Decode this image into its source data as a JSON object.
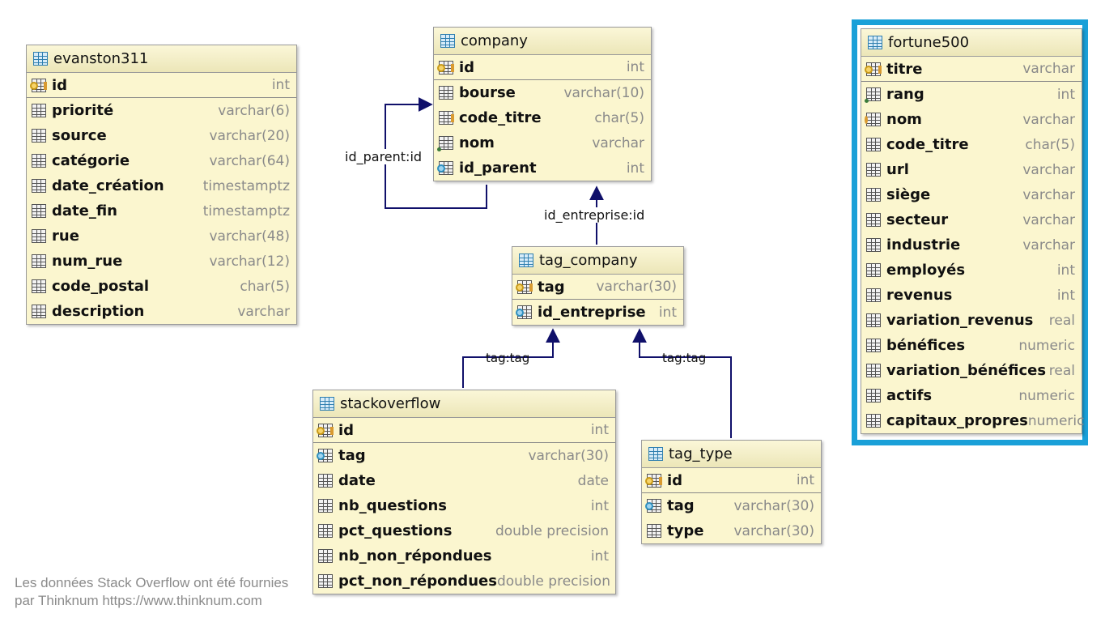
{
  "tables": {
    "evanston311": {
      "name": "evanston311",
      "fields": [
        {
          "name": "id",
          "type": "int"
        },
        {
          "name": "priorité",
          "type": "varchar(6)"
        },
        {
          "name": "source",
          "type": "varchar(20)"
        },
        {
          "name": "catégorie",
          "type": "varchar(64)"
        },
        {
          "name": "date_création",
          "type": "timestamptz"
        },
        {
          "name": "date_fin",
          "type": "timestamptz"
        },
        {
          "name": "rue",
          "type": "varchar(48)"
        },
        {
          "name": "num_rue",
          "type": "varchar(12)"
        },
        {
          "name": "code_postal",
          "type": "char(5)"
        },
        {
          "name": "description",
          "type": "varchar"
        }
      ]
    },
    "company": {
      "name": "company",
      "fields": [
        {
          "name": "id",
          "type": "int"
        },
        {
          "name": "bourse",
          "type": "varchar(10)"
        },
        {
          "name": "code_titre",
          "type": "char(5)"
        },
        {
          "name": "nom",
          "type": "varchar"
        },
        {
          "name": "id_parent",
          "type": "int"
        }
      ]
    },
    "tag_company": {
      "name": "tag_company",
      "fields": [
        {
          "name": "tag",
          "type": "varchar(30)"
        },
        {
          "name": "id_entreprise",
          "type": "int"
        }
      ]
    },
    "stackoverflow": {
      "name": "stackoverflow",
      "fields": [
        {
          "name": "id",
          "type": "int"
        },
        {
          "name": "tag",
          "type": "varchar(30)"
        },
        {
          "name": "date",
          "type": "date"
        },
        {
          "name": "nb_questions",
          "type": "int"
        },
        {
          "name": "pct_questions",
          "type": "double precision"
        },
        {
          "name": "nb_non_répondues",
          "type": "int"
        },
        {
          "name": "pct_non_répondues",
          "type": "double precision"
        }
      ]
    },
    "tag_type": {
      "name": "tag_type",
      "fields": [
        {
          "name": "id",
          "type": "int"
        },
        {
          "name": "tag",
          "type": "varchar(30)"
        },
        {
          "name": "type",
          "type": "varchar(30)"
        }
      ]
    },
    "fortune500": {
      "name": "fortune500",
      "fields": [
        {
          "name": "titre",
          "type": "varchar"
        },
        {
          "name": "rang",
          "type": "int"
        },
        {
          "name": "nom",
          "type": "varchar"
        },
        {
          "name": "code_titre",
          "type": "char(5)"
        },
        {
          "name": "url",
          "type": "varchar"
        },
        {
          "name": "siège",
          "type": "varchar"
        },
        {
          "name": "secteur",
          "type": "varchar"
        },
        {
          "name": "industrie",
          "type": "varchar"
        },
        {
          "name": "employés",
          "type": "int"
        },
        {
          "name": "revenus",
          "type": "int"
        },
        {
          "name": "variation_revenus",
          "type": "real"
        },
        {
          "name": "bénéfices",
          "type": "numeric"
        },
        {
          "name": "variation_bénéfices",
          "type": "real"
        },
        {
          "name": "actifs",
          "type": "numeric"
        },
        {
          "name": "capitaux_propres",
          "type": "numeric"
        }
      ]
    }
  },
  "relations": {
    "company_parent": "id_parent:id",
    "tag_company_company": "id_entreprise:id",
    "stackoverflow_tag": "tag:tag",
    "tag_type_tag": "tag:tag"
  },
  "highlight_color": "#1aa0d8",
  "footnote": {
    "line1": "Les données Stack Overflow ont été fournies",
    "line2": "par Thinknum https://www.thinknum.com"
  }
}
